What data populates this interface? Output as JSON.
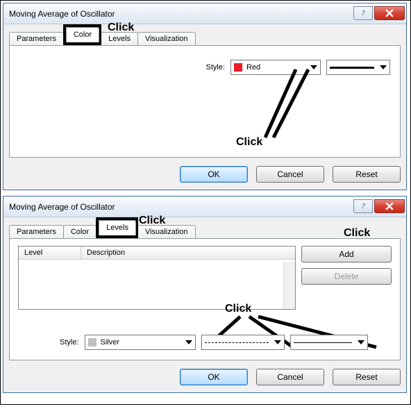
{
  "dialog1": {
    "title": "Moving Average of Oscillator",
    "tabs": {
      "parameters": "Parameters",
      "color": "Color",
      "levels": "Levels",
      "visualization": "Visualization"
    },
    "style_label": "Style:",
    "color_name": "Red",
    "buttons": {
      "ok": "OK",
      "cancel": "Cancel",
      "reset": "Reset"
    }
  },
  "dialog2": {
    "title": "Moving Average of Oscillator",
    "tabs": {
      "parameters": "Parameters",
      "color": "Color",
      "levels": "Levels",
      "visualization": "Visualization"
    },
    "columns": {
      "level": "Level",
      "description": "Description"
    },
    "add": "Add",
    "delete": "Delete",
    "style_label": "Style:",
    "color_name": "Silver",
    "buttons": {
      "ok": "OK",
      "cancel": "Cancel",
      "reset": "Reset"
    }
  },
  "annotations": {
    "click1": "Click",
    "click2": "Click",
    "click3": "Click",
    "click4": "Click",
    "click5": "Click"
  }
}
